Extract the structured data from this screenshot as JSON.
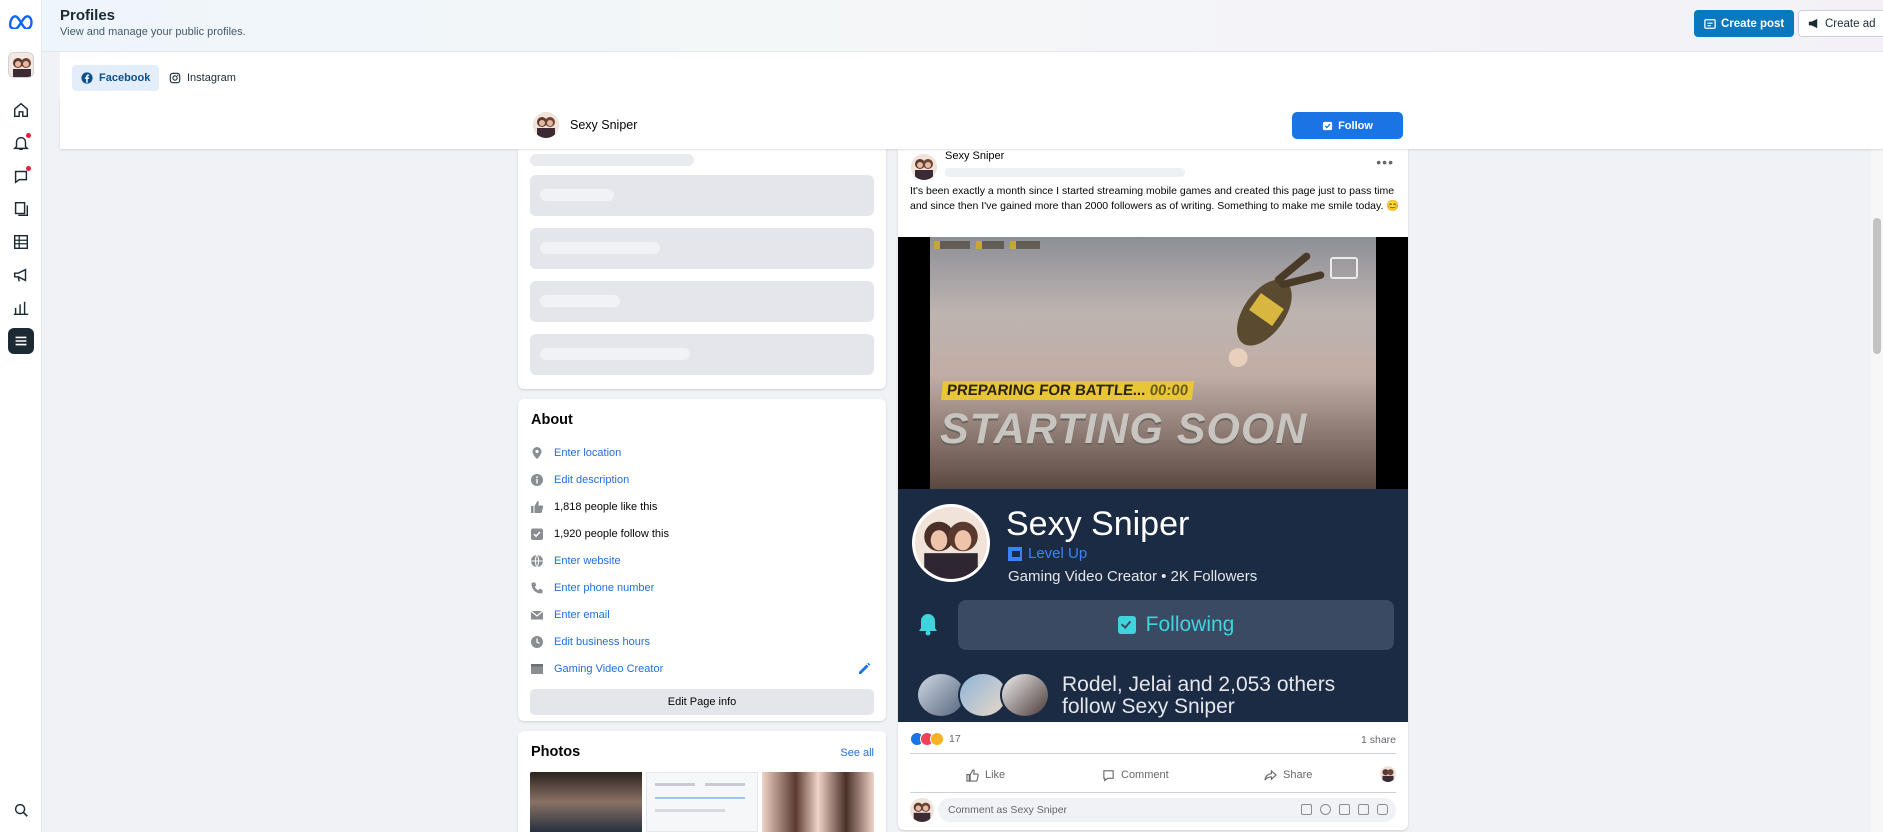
{
  "header": {
    "title": "Profiles",
    "subtitle": "View and manage your public profiles.",
    "create_post": "Create post",
    "create_ad": "Create ad"
  },
  "platform_tabs": [
    {
      "label": "Facebook",
      "selected": true
    },
    {
      "label": "Instagram",
      "selected": false
    }
  ],
  "profile": {
    "name": "Sexy Sniper",
    "follow_label": "Follow"
  },
  "about": {
    "title": "About",
    "location": "Enter location",
    "description": "Edit description",
    "likes": "1,818 people like this",
    "follows": "1,920 people follow this",
    "website": "Enter website",
    "phone": "Enter phone number",
    "email": "Enter email",
    "hours": "Edit business hours",
    "category": "Gaming Video Creator",
    "edit_button": "Edit Page info"
  },
  "photos": {
    "title": "Photos",
    "see_all": "See all"
  },
  "post": {
    "author": "Sexy Sniper",
    "text": "It's been exactly a month since I started streaming mobile games and created this page just to pass time and since then I've gained more than 2000 followers as of writing. Something to make me smile today. 😊",
    "video_text_1": "PREPARING FOR BATTLE...",
    "video_text_1_time": "00:00",
    "video_text_2": "STARTING SOON",
    "banner_name": "Sexy Sniper",
    "banner_platform": "Level Up",
    "banner_meta": "Gaming Video Creator • 2K Followers",
    "banner_button": "Following",
    "banner_followers_line1": "Rodel, Jelai and 2,053 others",
    "banner_followers_line2": "follow Sexy Sniper",
    "reaction_count": "17",
    "share_count": "1 share",
    "like": "Like",
    "comment": "Comment",
    "share": "Share",
    "comment_placeholder": "Comment as Sexy Sniper"
  },
  "colors": {
    "brand_blue": "#1b74e4",
    "link_blue": "#216fdb",
    "create_post_blue": "#0a78be",
    "banner_bg": "#1c2b44",
    "following_teal": "#40d3dc"
  },
  "icons": {
    "rail": [
      "meta-logo-icon",
      "home-icon",
      "notifications-icon",
      "messages-icon",
      "content-icon",
      "planner-icon",
      "ads-icon",
      "insights-icon",
      "menu-icon",
      "search-icon"
    ]
  }
}
